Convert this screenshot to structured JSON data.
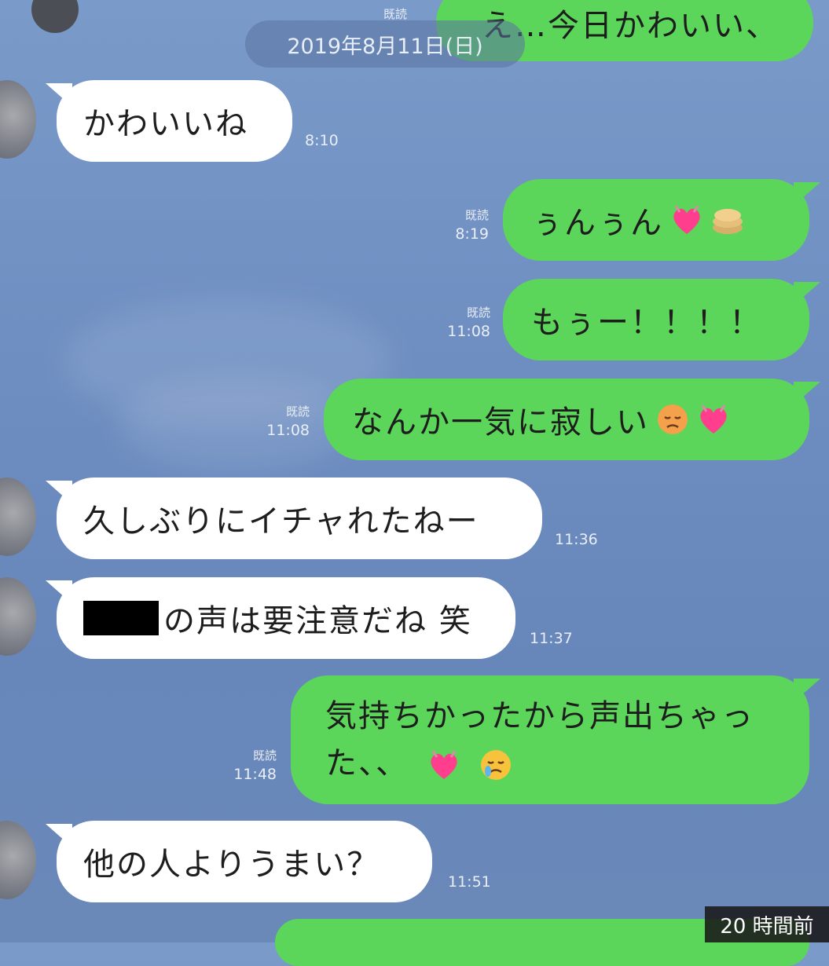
{
  "date_separator": "2019年8月11日(日)",
  "top_partial_message": "え…今日かわいい、",
  "top_read_label": "既読",
  "messages": [
    {
      "text": "かわいいね",
      "time": "8:10"
    },
    {
      "text": "ぅんぅん",
      "read": "既読",
      "time": "8:19",
      "emojis": [
        "heart-icon",
        "pancake-icon"
      ]
    },
    {
      "text": "もぅー！！！！",
      "read": "既読",
      "time": "11:08"
    },
    {
      "text": "なんか一気に寂しい",
      "read": "既読",
      "time": "11:08",
      "emojis": [
        "sad-face-icon",
        "heart-icon"
      ]
    },
    {
      "text": "久しぶりにイチャれたねー",
      "time": "11:36"
    },
    {
      "text": "の声は要注意だね 笑",
      "time": "11:37"
    },
    {
      "text_line1": "気持ちかったから声出ちゃっ",
      "text_line2": "た、、",
      "read": "既読",
      "time": "11:48",
      "emojis": [
        "heart-icon",
        "crying-face-icon"
      ]
    },
    {
      "text": "他の人よりうまい？",
      "time": "11:51"
    }
  ],
  "corner_badge": "20 時間前",
  "colors": {
    "outgoing_bubble": "#5cd65a",
    "incoming_bubble": "#ffffff",
    "background": "#7090c3"
  }
}
